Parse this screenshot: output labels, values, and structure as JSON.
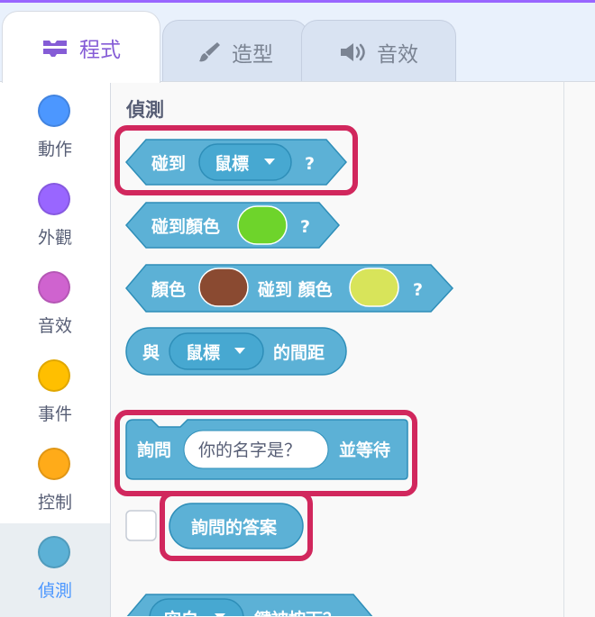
{
  "tabs": [
    {
      "label": "程式",
      "icon": "code-icon"
    },
    {
      "label": "造型",
      "icon": "paintbrush-icon"
    },
    {
      "label": "音效",
      "icon": "speaker-icon"
    }
  ],
  "categories": [
    {
      "label": "動作",
      "color": "#4c97ff"
    },
    {
      "label": "外觀",
      "color": "#9966ff"
    },
    {
      "label": "音效",
      "color": "#cf63cf"
    },
    {
      "label": "事件",
      "color": "#ffbf00"
    },
    {
      "label": "控制",
      "color": "#ffab19"
    },
    {
      "label": "偵測",
      "color": "#5cb1d6"
    }
  ],
  "palette": {
    "section_title": "偵測",
    "blocks": {
      "touching": {
        "prefix": "碰到",
        "dropdown": "鼠標",
        "suffix": "?"
      },
      "touching_color": {
        "prefix": "碰到顏色",
        "color": "#6ed42b",
        "suffix": "?"
      },
      "color_touching_color": {
        "prefix": "顏色",
        "color1": "#8a4a31",
        "middle": "碰到 顏色",
        "color2": "#d8e45a",
        "suffix": "?"
      },
      "distance_to": {
        "prefix": "與",
        "dropdown": "鼠標",
        "suffix": "的間距"
      },
      "ask_and_wait": {
        "prefix": "詢問",
        "input": "你的名字是？",
        "suffix": "並等待"
      },
      "answer": {
        "label": "詢問的答案"
      },
      "key_pressed": {
        "dropdown": "空白",
        "suffix": "鍵被按下？"
      }
    }
  },
  "colors": {
    "sensing_block": "#5cb1d6",
    "sensing_block_border": "#2e8eb8",
    "highlight": "#d1275d",
    "accent": "#855cd6"
  }
}
